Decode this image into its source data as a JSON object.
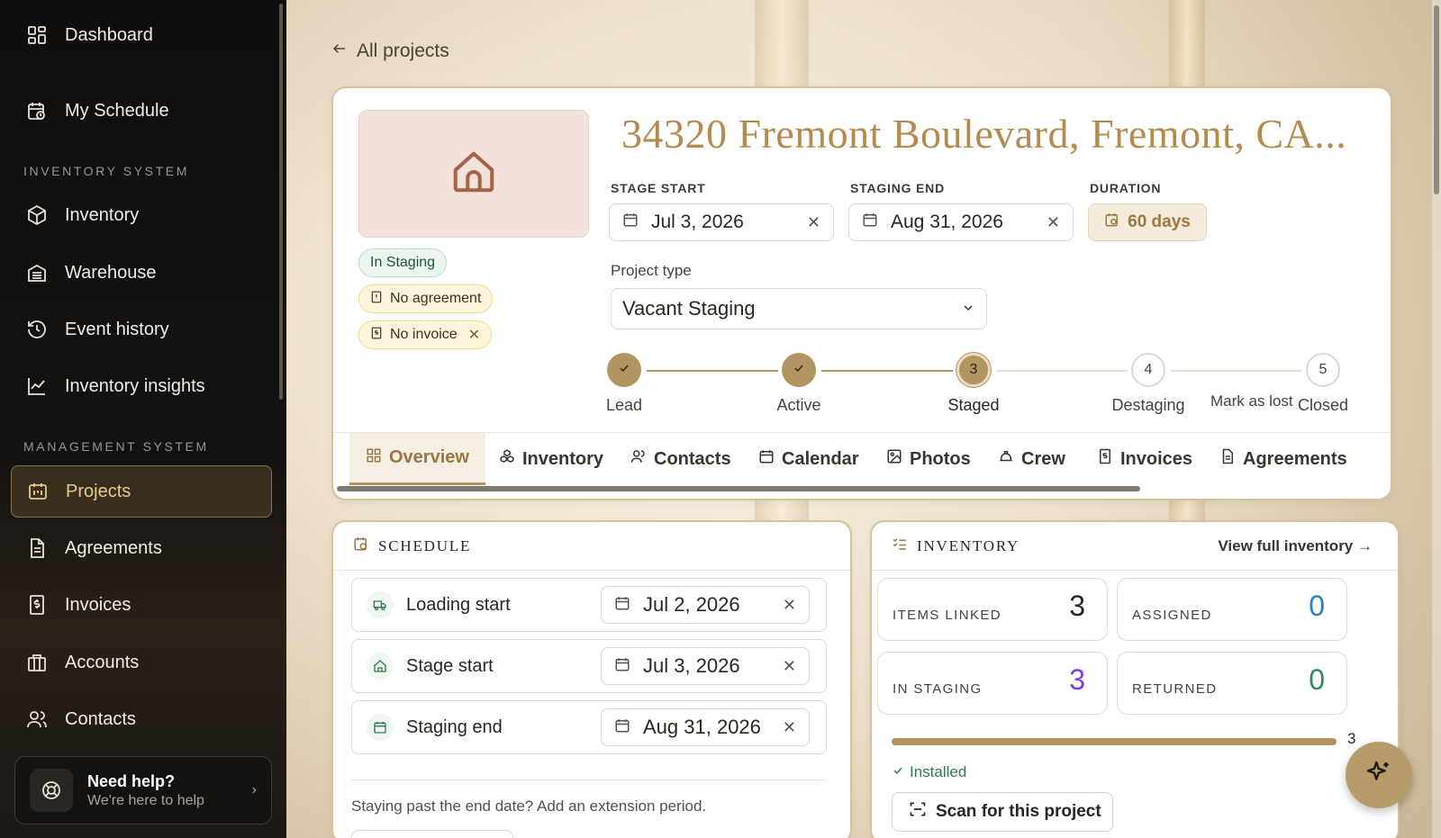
{
  "sidebar": {
    "items_top": [
      {
        "label": "Dashboard",
        "icon": "dashboard-grid-icon"
      },
      {
        "label": "My Schedule",
        "icon": "calendar-clock-icon"
      }
    ],
    "section_inventory": "INVENTORY SYSTEM",
    "items_inventory": [
      {
        "label": "Inventory",
        "icon": "box-icon"
      },
      {
        "label": "Warehouse",
        "icon": "warehouse-icon"
      },
      {
        "label": "Event history",
        "icon": "history-icon"
      },
      {
        "label": "Inventory insights",
        "icon": "line-chart-icon"
      }
    ],
    "section_management": "MANAGEMENT SYSTEM",
    "items_management": [
      {
        "label": "Projects",
        "icon": "projects-icon",
        "active": true
      },
      {
        "label": "Agreements",
        "icon": "document-icon"
      },
      {
        "label": "Invoices",
        "icon": "invoice-icon"
      },
      {
        "label": "Accounts",
        "icon": "accounts-icon"
      },
      {
        "label": "Contacts",
        "icon": "contacts-icon"
      }
    ],
    "help": {
      "title": "Need help?",
      "subtitle": "We're here to help"
    }
  },
  "back_link": "All projects",
  "project": {
    "title": "34320 Fremont Boulevard, Fremont, CA...",
    "badges": {
      "status": "In Staging",
      "agreement": "No agreement",
      "invoice": "No invoice"
    },
    "stage_start_label": "STAGE START",
    "stage_start": "Jul 3, 2026",
    "staging_end_label": "STAGING END",
    "staging_end": "Aug 31, 2026",
    "duration_label": "DURATION",
    "duration": "60 days",
    "project_type_label": "Project type",
    "project_type": "Vacant Staging",
    "steps": [
      {
        "num": "1",
        "label": "Lead",
        "state": "done"
      },
      {
        "num": "2",
        "label": "Active",
        "state": "done"
      },
      {
        "num": "3",
        "label": "Staged",
        "state": "current"
      },
      {
        "num": "4",
        "label": "Destaging",
        "state": "todo"
      },
      {
        "num": "5",
        "label": "Closed",
        "state": "todo"
      }
    ],
    "mark_as_lost": "Mark as lost",
    "tabs": [
      "Overview",
      "Inventory",
      "Contacts",
      "Calendar",
      "Photos",
      "Crew",
      "Invoices",
      "Agreements"
    ]
  },
  "schedule": {
    "title": "SCHEDULE",
    "rows": [
      {
        "label": "Loading start",
        "date": "Jul 2, 2026",
        "icon": "truck-icon"
      },
      {
        "label": "Stage start",
        "date": "Jul 3, 2026",
        "icon": "home-icon"
      },
      {
        "label": "Staging end",
        "date": "Aug 31, 2026",
        "icon": "calendar-icon"
      }
    ],
    "note": "Staying past the end date? Add an extension period."
  },
  "inventory": {
    "title": "INVENTORY",
    "view_link": "View full inventory",
    "stats": [
      {
        "label": "ITEMS LINKED",
        "value": "3",
        "color": "#2b2620"
      },
      {
        "label": "ASSIGNED",
        "value": "0",
        "color": "#2b7fc4"
      },
      {
        "label": "IN STAGING",
        "value": "3",
        "color": "#7a3fd6"
      },
      {
        "label": "RETURNED",
        "value": "0",
        "color": "#2f8a5c"
      }
    ],
    "progress_fraction": 1.0,
    "progress_count": "3",
    "installed_label": "Installed",
    "scan_button": "Scan for this project"
  },
  "colors": {
    "accent": "#b39561",
    "title": "#b48a4f"
  }
}
